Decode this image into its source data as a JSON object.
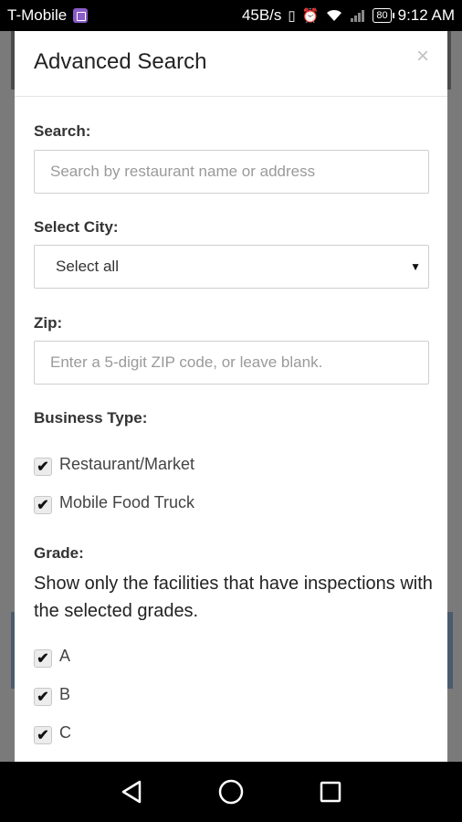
{
  "status_bar": {
    "carrier": "T-Mobile",
    "net_speed": "45B/s",
    "battery": "80",
    "time": "9:12 AM"
  },
  "modal": {
    "title": "Advanced Search",
    "close_label": "×",
    "search": {
      "label": "Search:",
      "placeholder": "Search by restaurant name or address",
      "value": ""
    },
    "city": {
      "label": "Select City:",
      "selected": "Select all",
      "caret": "▼"
    },
    "zip": {
      "label": "Zip:",
      "placeholder": "Enter a 5-digit ZIP code, or leave blank.",
      "value": ""
    },
    "business_type": {
      "label": "Business Type:",
      "options": [
        {
          "label": "Restaurant/Market",
          "checked": true
        },
        {
          "label": "Mobile Food Truck",
          "checked": true
        }
      ]
    },
    "grade": {
      "label": "Grade:",
      "description": "Show only the facilities that have inspections with the selected grades.",
      "options": [
        {
          "label": "A",
          "checked": true
        },
        {
          "label": "B",
          "checked": true
        },
        {
          "label": "C",
          "checked": true
        }
      ]
    }
  },
  "icons": {
    "check": "✔",
    "nav": [
      "back-icon",
      "home-icon",
      "recents-icon"
    ]
  },
  "colors": {
    "overlay": "#7a7a7a",
    "modal_bg": "#ffffff",
    "close": "#c2c2c2"
  }
}
